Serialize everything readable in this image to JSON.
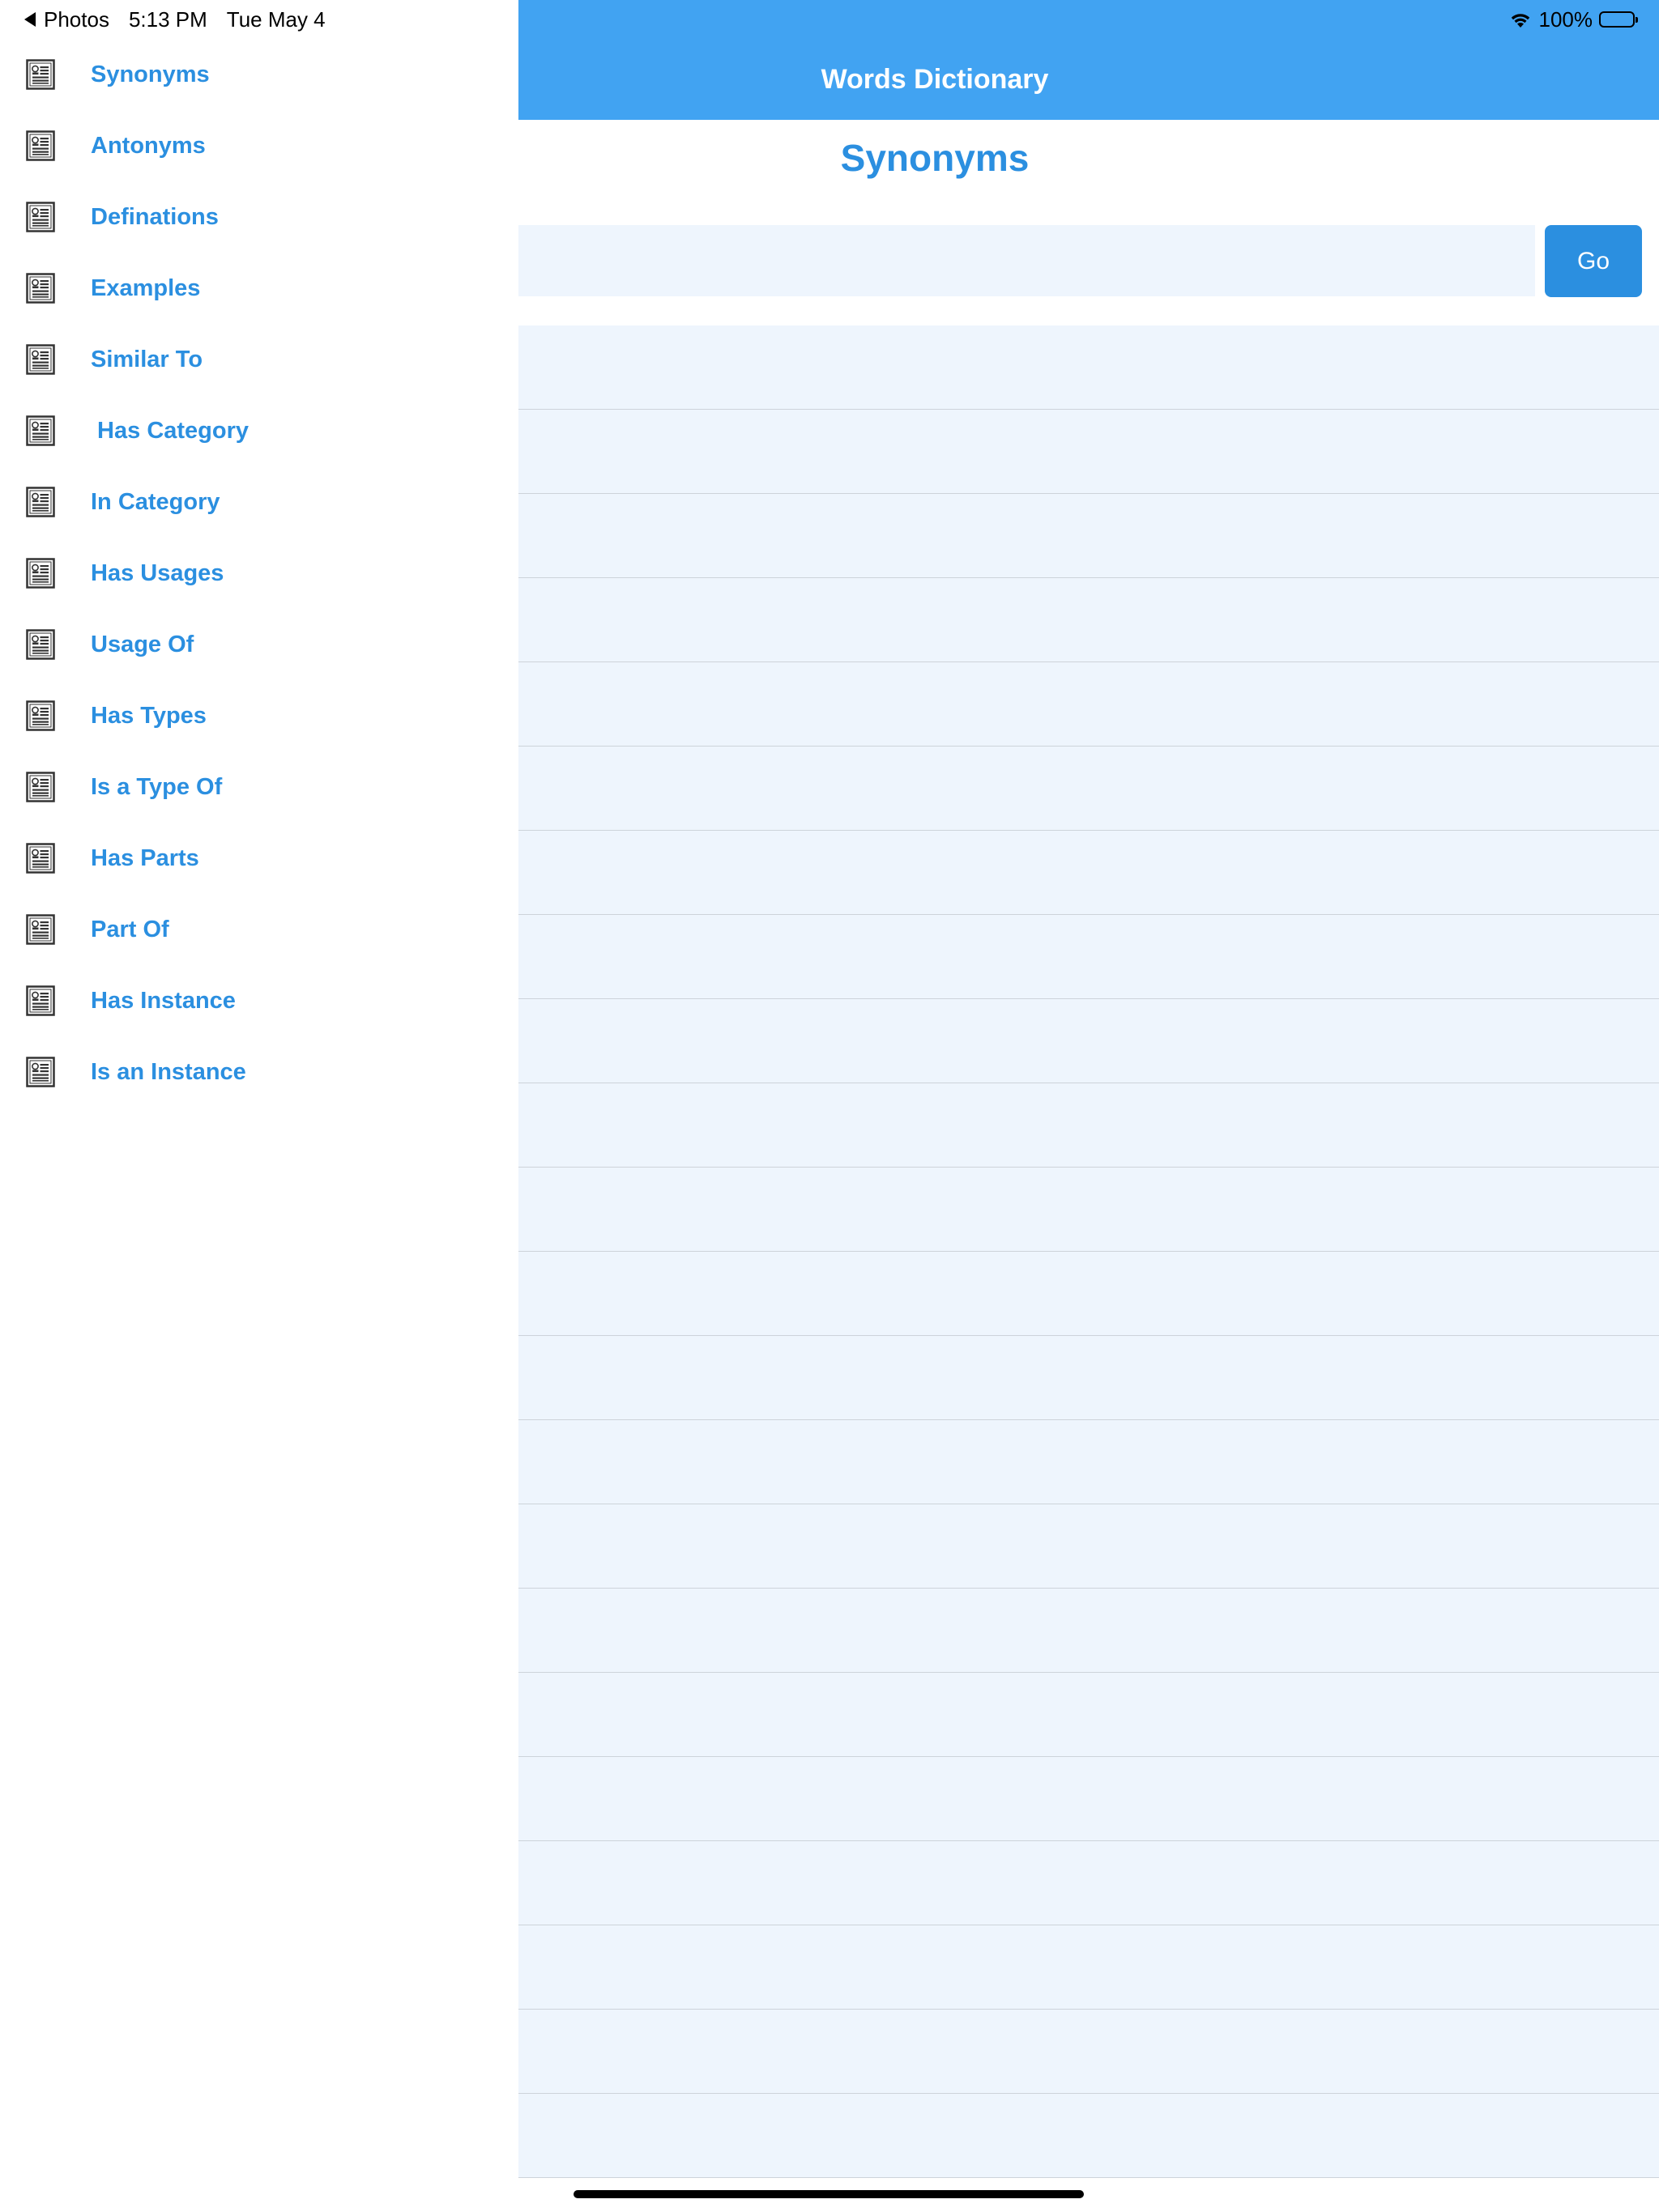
{
  "status_bar": {
    "back_app": "Photos",
    "time": "5:13 PM",
    "date": "Tue May 4",
    "battery": "100%"
  },
  "app": {
    "title": "Words Dictionary"
  },
  "page": {
    "title": "Synonyms"
  },
  "search": {
    "value": "",
    "placeholder": "",
    "go_label": "Go"
  },
  "sidebar": {
    "items": [
      {
        "label": "Synonyms",
        "icon": "document-icon"
      },
      {
        "label": "Antonyms",
        "icon": "document-icon"
      },
      {
        "label": "Definations",
        "icon": "document-icon"
      },
      {
        "label": "Examples",
        "icon": "document-icon"
      },
      {
        "label": "Similar To",
        "icon": "document-icon"
      },
      {
        "label": " Has Category",
        "icon": "document-icon"
      },
      {
        "label": "In Category",
        "icon": "document-icon"
      },
      {
        "label": "Has Usages",
        "icon": "document-icon"
      },
      {
        "label": "Usage Of",
        "icon": "document-icon"
      },
      {
        "label": "Has Types",
        "icon": "document-icon"
      },
      {
        "label": "Is a Type Of",
        "icon": "document-icon"
      },
      {
        "label": "Has Parts",
        "icon": "document-icon"
      },
      {
        "label": "Part Of",
        "icon": "document-icon"
      },
      {
        "label": "Has Instance",
        "icon": "document-icon"
      },
      {
        "label": "Is an Instance",
        "icon": "document-icon"
      }
    ]
  },
  "colors": {
    "accent": "#2b8fe0",
    "navbar": "#41a3f2",
    "list_background": "#eef5fd"
  }
}
